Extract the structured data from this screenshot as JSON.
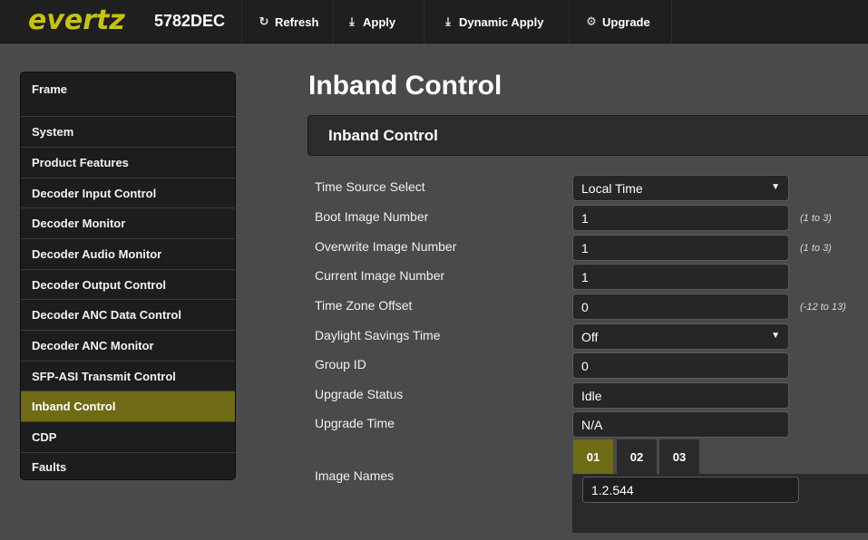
{
  "header": {
    "brand": "evertz",
    "model": "5782DEC",
    "buttons": [
      {
        "label": "Refresh",
        "icon": "refresh-icon"
      },
      {
        "label": "Apply",
        "icon": "download-arrow-icon"
      },
      {
        "label": "Dynamic Apply",
        "icon": "download-arrow-icon"
      },
      {
        "label": "Upgrade",
        "icon": "gear-icon"
      }
    ]
  },
  "sidebar": {
    "items": [
      {
        "label": "Frame"
      },
      {
        "label": "System"
      },
      {
        "label": "Product Features"
      },
      {
        "label": "Decoder Input Control"
      },
      {
        "label": "Decoder Monitor"
      },
      {
        "label": "Decoder Audio Monitor"
      },
      {
        "label": "Decoder Output Control"
      },
      {
        "label": "Decoder ANC Data Control"
      },
      {
        "label": "Decoder ANC Monitor"
      },
      {
        "label": "SFP-ASI Transmit Control"
      },
      {
        "label": "Inband Control",
        "active": true
      },
      {
        "label": "CDP"
      },
      {
        "label": "Faults"
      }
    ]
  },
  "main": {
    "title": "Inband Control",
    "section_title": "Inband Control",
    "fields": [
      {
        "label": "Time Source Select",
        "value": "Local Time",
        "type": "select",
        "range": ""
      },
      {
        "label": "Boot Image Number",
        "value": "1",
        "type": "input",
        "range": "(1 to 3)"
      },
      {
        "label": "Overwrite Image Number",
        "value": "1",
        "type": "input",
        "range": "(1 to 3)"
      },
      {
        "label": "Current Image Number",
        "value": "1",
        "type": "readonly",
        "range": ""
      },
      {
        "label": "Time Zone Offset",
        "value": "0",
        "type": "input",
        "range": "(-12 to 13)"
      },
      {
        "label": "Daylight Savings Time",
        "value": "Off",
        "type": "select",
        "range": ""
      },
      {
        "label": "Group ID",
        "value": "0",
        "type": "input",
        "range": ""
      },
      {
        "label": "Upgrade Status",
        "value": "Idle",
        "type": "readonly",
        "range": ""
      },
      {
        "label": "Upgrade Time",
        "value": "N/A",
        "type": "readonly",
        "range": ""
      }
    ],
    "image_names": {
      "label": "Image Names",
      "tabs": [
        "01",
        "02",
        "03"
      ],
      "active_tab": "01",
      "value": "1.2.544"
    }
  },
  "colors": {
    "brand_yellow": "#c6c215",
    "active_olive": "#6f6a16",
    "toolbar_bg": "#1f1f1f",
    "page_bg": "#4a4a4a"
  }
}
